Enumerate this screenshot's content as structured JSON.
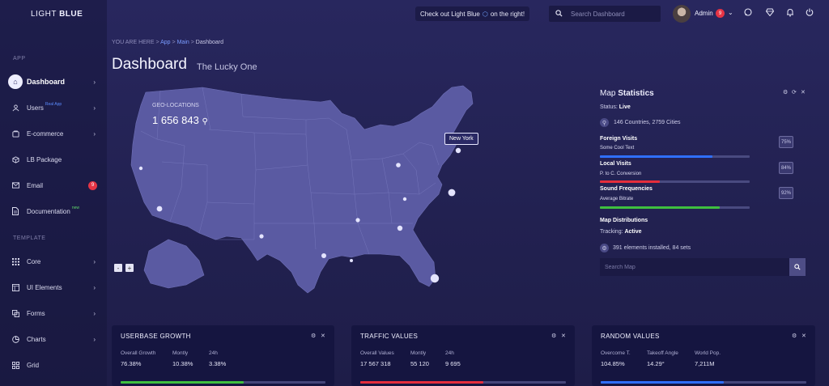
{
  "brand": {
    "light": "LIGHT",
    "bold": "BLUE"
  },
  "sidebar": {
    "sections": [
      {
        "label": "APP"
      },
      {
        "label": "TEMPLATE"
      }
    ],
    "app_items": [
      {
        "label": "Dashboard",
        "icon": "home-icon",
        "active": true,
        "chevron": true
      },
      {
        "label": "Users",
        "sup": "Real App",
        "icon": "user-icon",
        "chevron": true
      },
      {
        "label": "E-commerce",
        "icon": "cart-icon",
        "chevron": true
      },
      {
        "label": "LB Package",
        "icon": "package-icon"
      },
      {
        "label": "Email",
        "icon": "mail-icon",
        "badge": "9"
      },
      {
        "label": "Documentation",
        "sup": "new",
        "icon": "document-icon"
      }
    ],
    "template_items": [
      {
        "label": "Core",
        "icon": "grid-icon",
        "chevron": true
      },
      {
        "label": "UI Elements",
        "icon": "ui-elements-icon",
        "chevron": true
      },
      {
        "label": "Forms",
        "icon": "forms-icon",
        "chevron": true
      },
      {
        "label": "Charts",
        "icon": "pie-chart-icon",
        "chevron": true
      },
      {
        "label": "Grid",
        "icon": "layout-grid-icon"
      }
    ]
  },
  "topbar": {
    "promo_left": "Check out Light Blue",
    "promo_right": "on the right!",
    "search_placeholder": "Search Dashboard",
    "user_name": "Admin",
    "user_badge": "9"
  },
  "breadcrumb": {
    "prefix": "YOU ARE HERE",
    "items": [
      "App",
      "Main"
    ],
    "current": "Dashboard"
  },
  "page": {
    "title": "Dashboard",
    "subtitle": "The Lucky One"
  },
  "map": {
    "geo_label": "GEO-LOCATIONS",
    "geo_value": "1 656 843",
    "tooltip": "New York",
    "zoom_out": "-",
    "zoom_in": "+"
  },
  "map_stats": {
    "title_light": "Map",
    "title_bold": "Statistics",
    "status_label": "Status:",
    "status_value": "Live",
    "countries_text": "146 Countries, 2759 Cities",
    "metrics": [
      {
        "title": "Foreign Visits",
        "sub": "Some Cool Text",
        "percent": "75%",
        "value": 0.75,
        "color": "#2f6fff"
      },
      {
        "title": "Local Visits",
        "sub": "P. to C. Conversion",
        "percent": "84%",
        "value": 0.4,
        "color": "#e52d3c"
      },
      {
        "title": "Sound Frequencies",
        "sub": "Average Bitrate",
        "percent": "92%",
        "value": 0.8,
        "color": "#3fbf3f"
      }
    ],
    "distributions_title": "Map Distributions",
    "tracking_label": "Tracking:",
    "tracking_value": "Active",
    "installed_text": "391 elements installed, 84 sets",
    "search_placeholder": "Search Map"
  },
  "widgets": [
    {
      "title": "USERBASE GROWTH",
      "stats": [
        {
          "label": "Overall Growth",
          "value": "76.38%"
        },
        {
          "label": "Montly",
          "value": "10.38%"
        },
        {
          "label": "24h",
          "value": "3.38%"
        }
      ],
      "progress": 0.6,
      "color": "#3fbf3f"
    },
    {
      "title": "TRAFFIC VALUES",
      "stats": [
        {
          "label": "Overall Values",
          "value": "17 567 318"
        },
        {
          "label": "Montly",
          "value": "55 120"
        },
        {
          "label": "24h",
          "value": "9 695"
        }
      ],
      "progress": 0.6,
      "color": "#e52d3c"
    },
    {
      "title": "RANDOM VALUES",
      "stats": [
        {
          "label": "Overcome T.",
          "value": "104.85%"
        },
        {
          "label": "Takeoff Angle",
          "value": "14.29°"
        },
        {
          "label": "World Pop.",
          "value": "7,211M"
        }
      ],
      "progress": 0.6,
      "color": "#2f6fff"
    }
  ]
}
